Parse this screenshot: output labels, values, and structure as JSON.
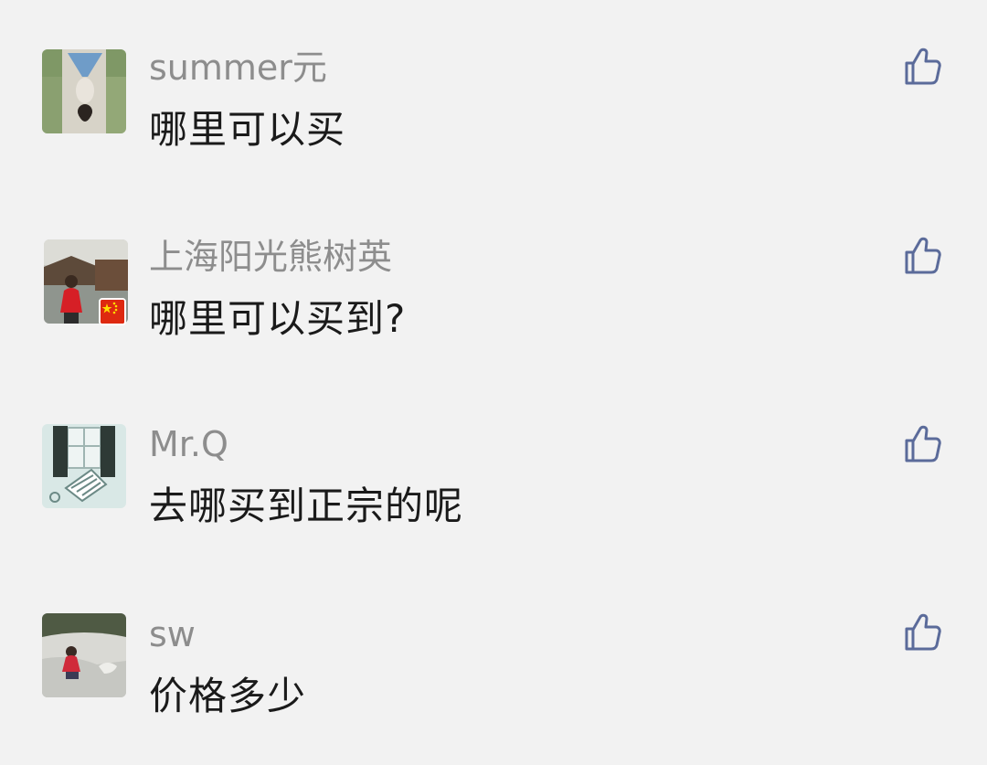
{
  "comments": [
    {
      "author": "summer元",
      "text": "哪里可以买",
      "avatar_icon": "girl-lying-on-path-avatar",
      "liked": false
    },
    {
      "author": "上海阳光熊树英",
      "text": "哪里可以买到?",
      "avatar_icon": "woman-by-water-town-avatar",
      "badge_icon": "china-flag-icon",
      "liked": false
    },
    {
      "author": "Mr.Q",
      "text": "去哪买到正宗的呢",
      "avatar_icon": "window-illustration-avatar",
      "liked": false
    },
    {
      "author": "sw",
      "text": "价格多少",
      "avatar_icon": "child-in-snow-avatar",
      "liked": false
    }
  ],
  "colors": {
    "background": "#f2f2f2",
    "author": "#8d8d8d",
    "text": "#1a1a1a",
    "like_icon": "#5b6b9a"
  }
}
